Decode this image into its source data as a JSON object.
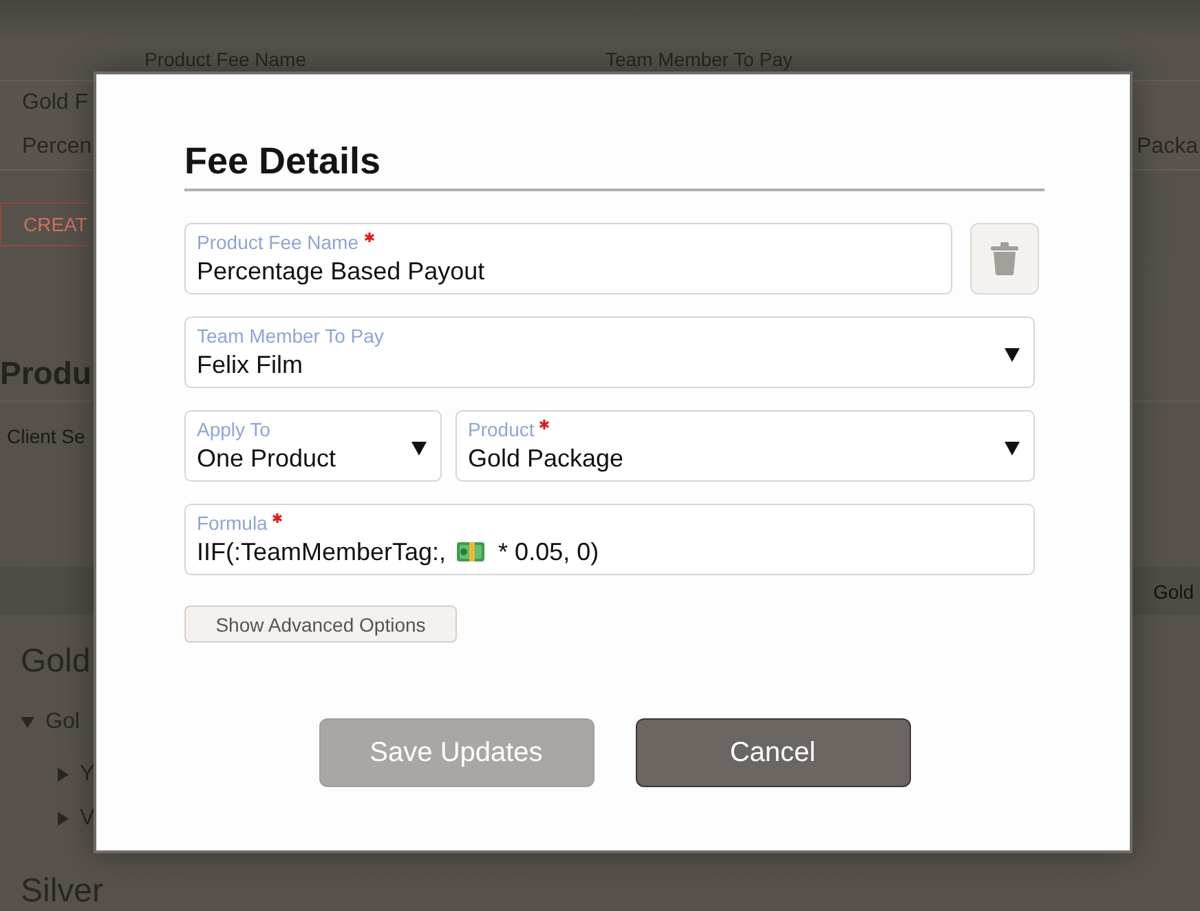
{
  "background": {
    "table": {
      "columns": [
        "Product Fee Name",
        "Team Member To Pay"
      ],
      "rows": [
        {
          "column_1": "Gold F"
        },
        {
          "column_1": "Percen",
          "column_3": "Packa"
        }
      ]
    },
    "create_button": "CREAT",
    "section": {
      "title": "Produ",
      "hint": "Client Se"
    },
    "header_bar": {
      "column_label": "Gold"
    },
    "groups": [
      {
        "title": "Gold",
        "tree": [
          {
            "label": "Gol",
            "expanded": true,
            "children": [
              {
                "label": "Y",
                "expanded": false
              },
              {
                "label": "V",
                "expanded": false
              }
            ]
          }
        ]
      },
      {
        "title": "Silver"
      }
    ]
  },
  "dialog": {
    "title": "Fee Details",
    "rows": [
      {
        "delete_button": true,
        "fields": [
          {
            "kind": "text",
            "label": "Product Fee Name",
            "required": true,
            "value": "Percentage Based Payout"
          }
        ]
      },
      {
        "fields": [
          {
            "kind": "select",
            "label": "Team Member To Pay",
            "required": false,
            "value": "Felix Film"
          }
        ]
      },
      {
        "fields": [
          {
            "kind": "select",
            "label": "Apply To",
            "required": false,
            "value": "One Product"
          },
          {
            "kind": "select",
            "label": "Product",
            "required": true,
            "value": "Gold Package"
          }
        ]
      },
      {
        "fields": [
          {
            "kind": "formula",
            "label": "Formula",
            "required": true,
            "value_parts": [
              {
                "kind": "text",
                "text": "IIF(:TeamMemberTag:,"
              },
              {
                "kind": "token"
              },
              {
                "kind": "text",
                "text": "* 0.05, 0)"
              }
            ]
          }
        ]
      }
    ],
    "advanced_button": "Show Advanced Options",
    "buttons": [
      {
        "kind": "primary",
        "label": "Save Updates",
        "disabled": true
      },
      {
        "kind": "secondary",
        "label": "Cancel",
        "disabled": false
      }
    ]
  }
}
